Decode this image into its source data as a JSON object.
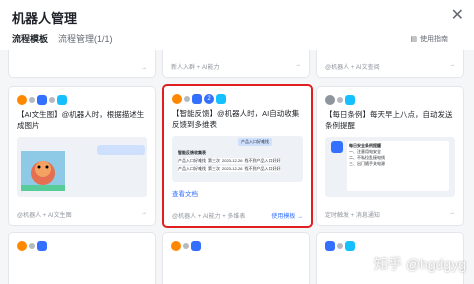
{
  "window": {
    "title": "机器人管理"
  },
  "tabs": [
    {
      "label": "流程模板"
    },
    {
      "label": "流程管理(1/1)"
    }
  ],
  "help": {
    "label": "使用指南"
  },
  "top_row": [
    {
      "footer": ""
    },
    {
      "footer": "新人入群 + AI能力"
    },
    {
      "footer": "@机器人 + AI文查阅"
    }
  ],
  "cards": [
    {
      "title": "【AI文生图】@机器人时，根据描述生成图片",
      "footer": "@机器人 + AI文生图",
      "badge": ""
    },
    {
      "title": "【智能反馈】@机器人时，AI自动收集反馈到多维表",
      "badge": "2",
      "view_doc": "查看文档",
      "footer": "@机器人 + AI能力 + 多维表",
      "use_template": "使用模板",
      "preview_labels": {
        "bubble": "产品入口好难找",
        "table_title": "智能反馈收集表",
        "header": [
          "产品入口好难找",
          "第三次",
          "2023-12-26",
          "找不到产品入口好好"
        ],
        "row": [
          "产品入口好难找",
          "第三次",
          "2023-12-26",
          "找不到产品入口好好"
        ]
      }
    },
    {
      "title": "【每日条例】每天早上八点，自动发送条例提醒",
      "footer": "定时触发 + 消息通知",
      "badge": "",
      "preview_lines": [
        "每日安全条例提醒",
        "一、注意用电安全",
        "二、不私拉乱接电线",
        "三、出门随手关电源"
      ]
    }
  ],
  "watermark": "知乎 @hgdgyg"
}
